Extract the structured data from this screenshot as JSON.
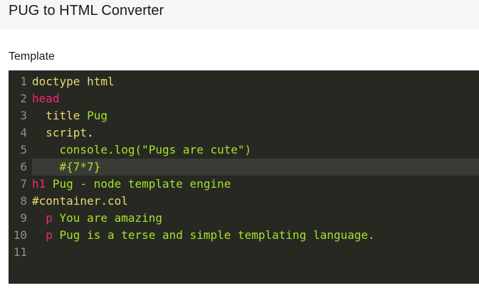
{
  "app": {
    "title": "PUG to HTML Converter"
  },
  "editor": {
    "label": "Template",
    "line_numbers": [
      "1",
      "2",
      "3",
      "4",
      "5",
      "6",
      "7",
      "8",
      "9",
      "10",
      "11"
    ],
    "lines": [
      {
        "indent": "",
        "tokens": [
          {
            "t": "doctype",
            "c": "txt"
          },
          {
            "t": " ",
            "c": "punc"
          },
          {
            "t": "html",
            "c": "txt"
          }
        ]
      },
      {
        "indent": "",
        "tokens": [
          {
            "t": "head",
            "c": "tag"
          }
        ]
      },
      {
        "indent": "  ",
        "tokens": [
          {
            "t": "title",
            "c": "txt"
          },
          {
            "t": " Pug",
            "c": "js"
          }
        ]
      },
      {
        "indent": "  ",
        "tokens": [
          {
            "t": "script",
            "c": "txt"
          },
          {
            "t": ".",
            "c": "punc"
          }
        ]
      },
      {
        "indent": "    ",
        "tokens": [
          {
            "t": "console.log(\"Pugs are cute\")",
            "c": "js"
          }
        ]
      },
      {
        "indent": "    ",
        "tokens": [
          {
            "t": "#{7*7}",
            "c": "js"
          }
        ]
      },
      {
        "indent": "",
        "tokens": [
          {
            "t": "h1",
            "c": "tag"
          },
          {
            "t": " Pug - node template engine",
            "c": "js"
          }
        ]
      },
      {
        "indent": "",
        "tokens": [
          {
            "t": "#container.col",
            "c": "txt"
          }
        ]
      },
      {
        "indent": "  ",
        "tokens": [
          {
            "t": "p",
            "c": "tag"
          },
          {
            "t": " You are amazing",
            "c": "js"
          }
        ]
      },
      {
        "indent": "  ",
        "tokens": [
          {
            "t": "p",
            "c": "tag"
          },
          {
            "t": " Pug is a terse and simple templating language.",
            "c": "js"
          }
        ]
      },
      {
        "indent": "",
        "tokens": []
      }
    ],
    "active_line": 6,
    "colors": {
      "background": "#272822",
      "gutter_text": "#8f908a",
      "active_line": "#3a3b34",
      "tag": "#f92672",
      "string": "#e6db74",
      "code": "#a6e22e"
    }
  }
}
